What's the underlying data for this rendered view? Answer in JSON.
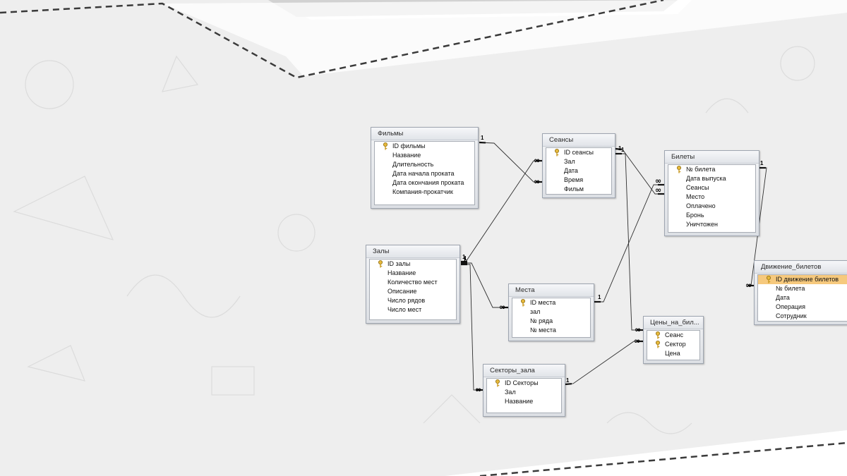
{
  "tables": [
    {
      "id": "films",
      "title": "Фильмы",
      "fields": [
        {
          "name": "ID фильмы",
          "key": true
        },
        {
          "name": "Название"
        },
        {
          "name": "Длительность"
        },
        {
          "name": "Дата начала проката"
        },
        {
          "name": "Дата окончания проката"
        },
        {
          "name": "Компания-прокатчик"
        }
      ]
    },
    {
      "id": "sessions",
      "title": "Сеансы",
      "fields": [
        {
          "name": "ID сеансы",
          "key": true
        },
        {
          "name": "Зал"
        },
        {
          "name": "Дата"
        },
        {
          "name": "Время"
        },
        {
          "name": "Фильм"
        }
      ]
    },
    {
      "id": "tickets",
      "title": "Билеты",
      "fields": [
        {
          "name": "№ билета",
          "key": true
        },
        {
          "name": "Дата выпуска"
        },
        {
          "name": "Сеансы"
        },
        {
          "name": "Место"
        },
        {
          "name": "Оплачено"
        },
        {
          "name": "Бронь"
        },
        {
          "name": "Уничтожен"
        }
      ]
    },
    {
      "id": "halls",
      "title": "Залы",
      "fields": [
        {
          "name": "ID залы",
          "key": true
        },
        {
          "name": "Название"
        },
        {
          "name": "Количество мест"
        },
        {
          "name": "Описание"
        },
        {
          "name": "Число рядов"
        },
        {
          "name": "Число мест"
        }
      ]
    },
    {
      "id": "seats",
      "title": "Места",
      "fields": [
        {
          "name": "ID места",
          "key": true
        },
        {
          "name": "зал"
        },
        {
          "name": "№ ряда"
        },
        {
          "name": "№ места"
        }
      ]
    },
    {
      "id": "prices",
      "title": "Цены_на_бил...",
      "fields": [
        {
          "name": "Сеанс",
          "key": true
        },
        {
          "name": "Сектор",
          "key": true
        },
        {
          "name": "Цена"
        }
      ]
    },
    {
      "id": "movement",
      "title": "Движение_билетов",
      "fields": [
        {
          "name": "ID движение билетов",
          "key": true,
          "selected": true
        },
        {
          "name": "№ билета"
        },
        {
          "name": "Дата"
        },
        {
          "name": "Операция"
        },
        {
          "name": "Сотрудник"
        }
      ]
    },
    {
      "id": "sectors",
      "title": "Секторы_зала",
      "fields": [
        {
          "name": "ID Секторы",
          "key": true
        },
        {
          "name": "Зал"
        },
        {
          "name": "Название"
        }
      ]
    }
  ],
  "relations": [
    {
      "from": "films",
      "to": "sessions",
      "from_card": "1",
      "to_card": "∞"
    },
    {
      "from": "halls",
      "to": "sessions",
      "from_card": "1",
      "to_card": "∞"
    },
    {
      "from": "sessions",
      "to": "tickets",
      "from_card": "1",
      "to_card": "∞"
    },
    {
      "from": "halls",
      "to": "seats",
      "from_card": "1",
      "to_card": "∞"
    },
    {
      "from": "seats",
      "to": "tickets",
      "from_card": "1",
      "to_card": "∞"
    },
    {
      "from": "sessions",
      "to": "prices",
      "from_card": "1",
      "to_card": "∞"
    },
    {
      "from": "halls",
      "to": "sectors",
      "from_card": "1",
      "to_card": "∞"
    },
    {
      "from": "sectors",
      "to": "prices",
      "from_card": "1",
      "to_card": "∞"
    },
    {
      "from": "tickets",
      "to": "movement",
      "from_card": "1",
      "to_card": "∞"
    }
  ],
  "colors": {
    "background": "#eeeeee",
    "accent_band": "#d2d2d2",
    "selected_field": "#f6c97d",
    "relation_line": "#2e2e2e"
  },
  "icons": {
    "primary_key": "key-icon"
  }
}
